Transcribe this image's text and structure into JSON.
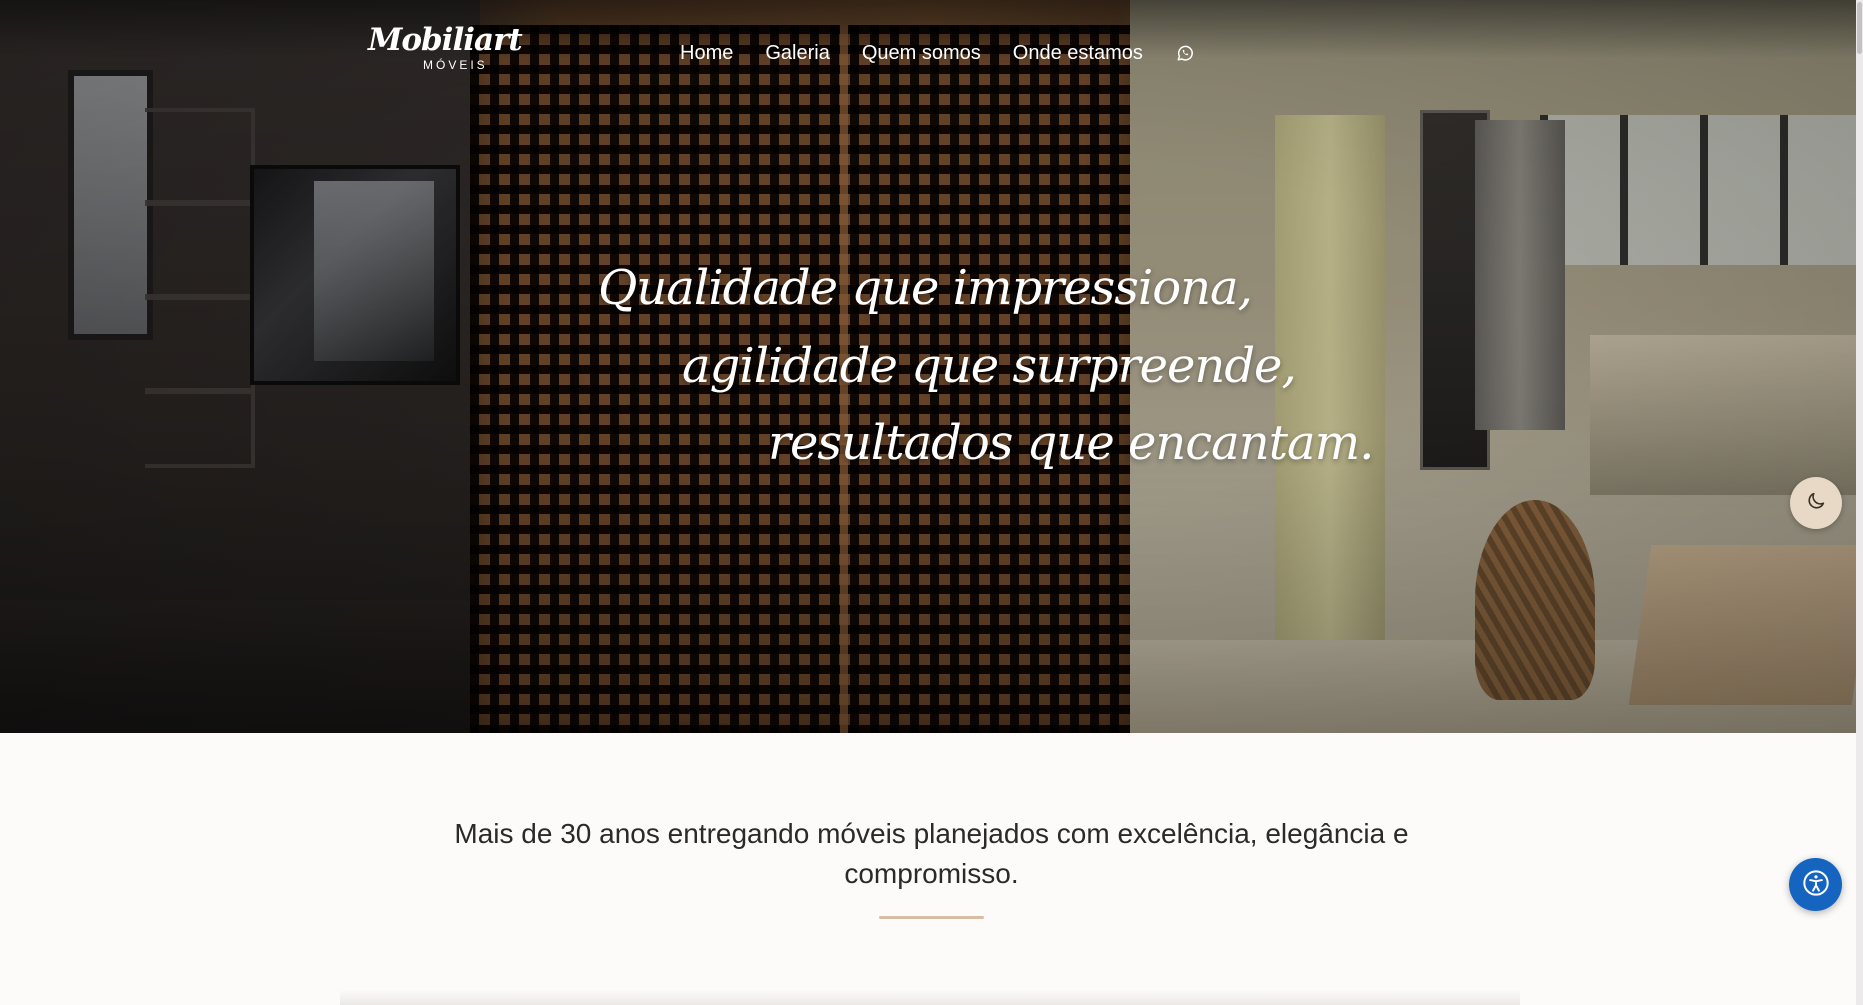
{
  "brand": {
    "name": "Mobiliart",
    "subtitle": "MÓVEIS"
  },
  "nav": {
    "items": [
      {
        "label": "Home"
      },
      {
        "label": "Galeria"
      },
      {
        "label": "Quem somos"
      },
      {
        "label": "Onde estamos"
      }
    ],
    "whatsapp_icon": "whatsapp-icon"
  },
  "hero": {
    "lines": [
      "Qualidade que impressiona,",
      "agilidade que surpreende,",
      "resultados que encantam."
    ]
  },
  "theme_toggle": {
    "icon": "moon-icon"
  },
  "intro": {
    "text": "Mais de 30 anos entregando móveis planejados com excelência, elegância e compromisso."
  },
  "accessibility": {
    "icon": "accessibility-icon"
  },
  "colors": {
    "accent": "#d9bda3",
    "accessibility_button": "#1565c0",
    "theme_toggle_bg": "#e8d9c6"
  }
}
